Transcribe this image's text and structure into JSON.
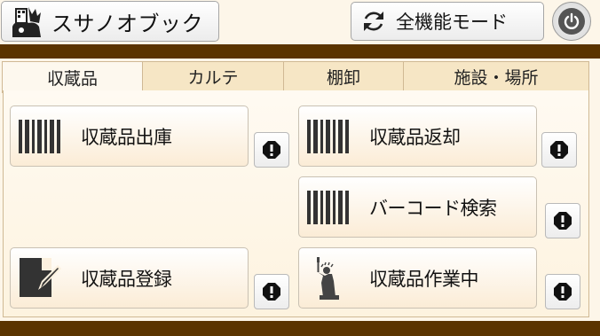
{
  "header": {
    "app_button_label": "スサノオブック",
    "mode_button_label": "全機能モード"
  },
  "tabs": [
    {
      "label": "収蔵品",
      "active": true
    },
    {
      "label": "カルテ",
      "active": false
    },
    {
      "label": "棚卸",
      "active": false
    },
    {
      "label": "施設・場所",
      "active": false
    }
  ],
  "actions": {
    "checkout": {
      "label": "収蔵品出庫",
      "icon": "barcode-icon"
    },
    "return": {
      "label": "収蔵品返却",
      "icon": "barcode-icon"
    },
    "barcode_search": {
      "label": "バーコード検索",
      "icon": "barcode-icon"
    },
    "register": {
      "label": "収蔵品登録",
      "icon": "edit-icon"
    },
    "in_progress": {
      "label": "収蔵品作業中",
      "icon": "statue-of-liberty-icon"
    }
  },
  "colors": {
    "brown_strip": "#5a3400",
    "tab_inactive": "#f6e6c5",
    "background": "#fdf6e9"
  }
}
